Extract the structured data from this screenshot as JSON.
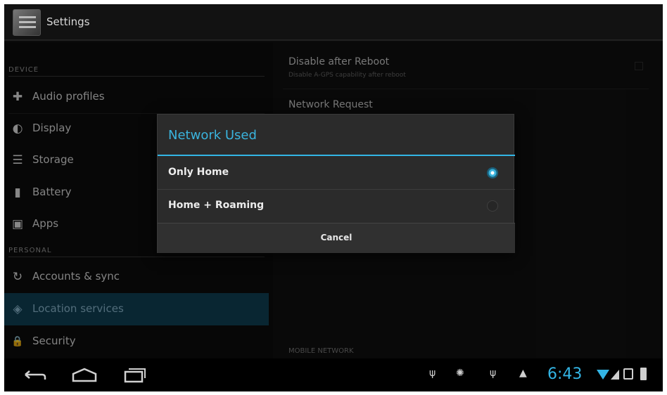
{
  "app": {
    "title": "Settings"
  },
  "sidebar": {
    "sections": [
      {
        "header": "DEVICE"
      },
      {
        "header": "PERSONAL"
      }
    ],
    "items": [
      {
        "label": "Audio profiles",
        "icon": "audio-profiles-icon",
        "glyph": "✚"
      },
      {
        "label": "Display",
        "icon": "display-icon",
        "glyph": "◐"
      },
      {
        "label": "Storage",
        "icon": "storage-icon",
        "glyph": "☰"
      },
      {
        "label": "Battery",
        "icon": "battery-icon",
        "glyph": "▮"
      },
      {
        "label": "Apps",
        "icon": "apps-icon",
        "glyph": "▣"
      },
      {
        "label": "Accounts & sync",
        "icon": "sync-icon",
        "glyph": "↻"
      },
      {
        "label": "Location services",
        "icon": "location-icon",
        "glyph": "◈",
        "selected": true
      },
      {
        "label": "Security",
        "icon": "lock-icon",
        "glyph": "🔒"
      }
    ]
  },
  "detail": {
    "prefs": [
      {
        "title": "Disable after Reboot",
        "summary": "Disable A-GPS capability after reboot"
      },
      {
        "title": "Network Request",
        "summary": ""
      }
    ],
    "section_header": "MOBILE NETWORK"
  },
  "dialog": {
    "title": "Network Used",
    "options": [
      {
        "label": "Only Home",
        "checked": true
      },
      {
        "label": "Home + Roaming",
        "checked": false
      }
    ],
    "cancel_label": "Cancel"
  },
  "status_bar": {
    "time": "6:43",
    "accent": "#33b5e5"
  }
}
